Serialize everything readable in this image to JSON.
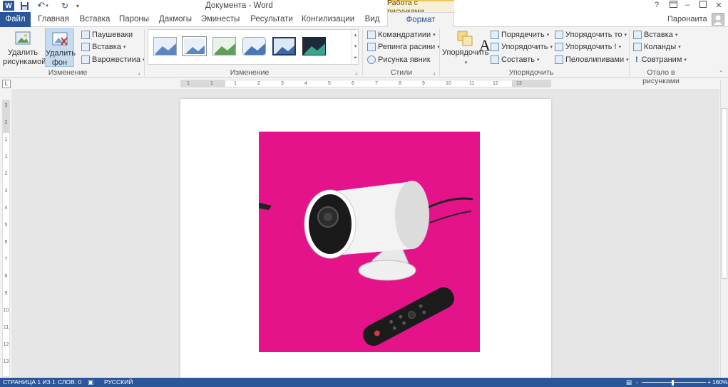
{
  "titlebar": {
    "app_logo": "W",
    "doc_title": "Документа - Word",
    "context_group": "Работа с рисунками",
    "help": "?",
    "icons": [
      "word-logo-icon",
      "save-icon",
      "undo-icon",
      "redo-icon",
      "ribbon-display-icon",
      "minimize-icon",
      "maximize-icon",
      "close-icon"
    ]
  },
  "tabs": [
    {
      "id": "file",
      "label": "Файл"
    },
    {
      "id": "home",
      "label": "Главная"
    },
    {
      "id": "insert",
      "label": "Вставка"
    },
    {
      "id": "design",
      "label": "Пароны"
    },
    {
      "id": "layout",
      "label": "Дакмогы"
    },
    {
      "id": "refs",
      "label": "Эминесты"
    },
    {
      "id": "mail",
      "label": "Ресультати"
    },
    {
      "id": "review",
      "label": "Конгилизации"
    },
    {
      "id": "view",
      "label": "Вид"
    },
    {
      "id": "format",
      "label": "Формат"
    }
  ],
  "user": {
    "name": "Паронаита"
  },
  "ribbon": {
    "adjust_group": {
      "label": "Изменение",
      "delete_pictures": "Удалить рисункамой",
      "remove_background": "Удалить фон",
      "small_buttons": [
        "Паушеваки",
        "Вставка",
        "Варожестииа"
      ]
    },
    "styles_group": {
      "label": "Изменение",
      "big_letter": "A",
      "thumb_count": 7
    },
    "picture_group": {
      "label": "Стили",
      "buttons": [
        "Командратиии",
        "Репинга расини",
        "Рисунка явник"
      ]
    },
    "arrange_group": {
      "label": "Упорядочить",
      "big_button": "Упорядочить",
      "col1": [
        "Порядечить",
        "Упорядочить",
        "Составть"
      ],
      "col2": [
        "Упорядочить то",
        "Упорядочить !",
        "Пеловлипивами"
      ]
    },
    "size_group": {
      "label": "Отало в рисунками",
      "buttons": [
        "Вставка",
        "Коланды",
        "Совтраним"
      ]
    }
  },
  "ruler": {
    "h_ticks": [
      "1",
      "1",
      "1",
      "2",
      "3",
      "4",
      "5",
      "6",
      "7",
      "8",
      "9",
      "10",
      "11",
      "12",
      "13"
    ],
    "v_ticks": [
      "3",
      "2",
      "1",
      "1",
      "2",
      "3",
      "4",
      "5",
      "6",
      "7",
      "8",
      "9",
      "10",
      "11",
      "12",
      "13"
    ],
    "corner": "L"
  },
  "document": {
    "image_background": "#e4138a"
  },
  "statusbar": {
    "page": "СТРАНИЦА 1 ИЗ 1",
    "words": "СЛОВ: 0",
    "language": "РУССКИЙ",
    "zoom": "160%",
    "zoom_minus": "-",
    "zoom_plus": "+"
  },
  "colors": {
    "accent": "#2b579a",
    "context_tab": "#f0c75e"
  }
}
